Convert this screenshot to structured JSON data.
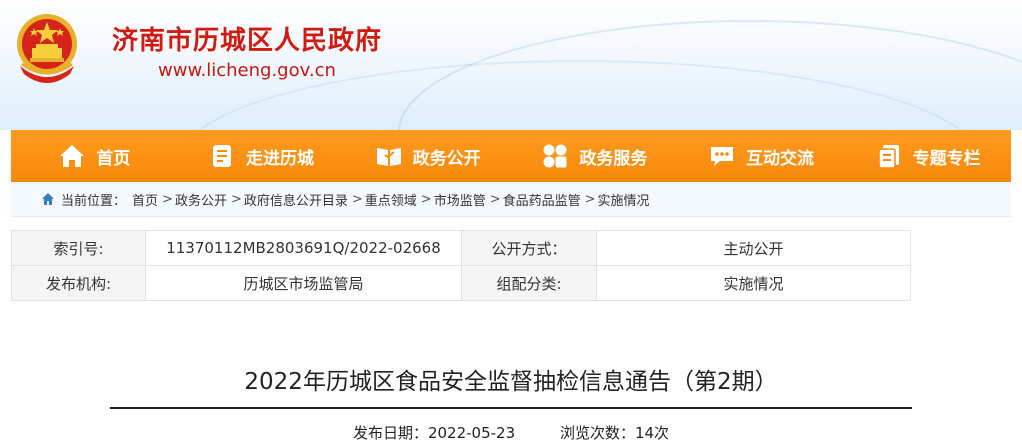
{
  "site": {
    "name": "济南市历城区人民政府",
    "url": "www.licheng.gov.cn",
    "emblem_icon": "national-emblem-icon"
  },
  "colors": {
    "nav_bg": "#f7890b",
    "title_red": "#d01a12",
    "text": "#333333"
  },
  "nav": [
    {
      "label": "首页",
      "icon": "home-icon"
    },
    {
      "label": "走进历城",
      "icon": "document-icon"
    },
    {
      "label": "政务公开",
      "icon": "open-book-icon"
    },
    {
      "label": "政务服务",
      "icon": "services-grid-icon"
    },
    {
      "label": "互动交流",
      "icon": "chat-bubble-icon"
    },
    {
      "label": "专题专栏",
      "icon": "topics-icon"
    }
  ],
  "breadcrumb": {
    "prefix": "当前位置：",
    "items": [
      "首页",
      "政务公开",
      "政府信息公开目录",
      "重点领域",
      "市场监管",
      "食品药品监管",
      "实施情况"
    ]
  },
  "info_table": {
    "row1": {
      "label1": "索引号:",
      "value1": "11370112MB2803691Q/2022-02668",
      "label2": "公开方式：",
      "value2": "主动公开"
    },
    "row2": {
      "label1": "发布机构:",
      "value1": "历城区市场监管局",
      "label2": "组配分类:",
      "value2": "实施情况"
    }
  },
  "article": {
    "title": "2022年历城区食品安全监督抽检信息通告（第2期）",
    "date_label": "发布日期：2022-05-23",
    "views_label": "浏览次数：14次"
  }
}
